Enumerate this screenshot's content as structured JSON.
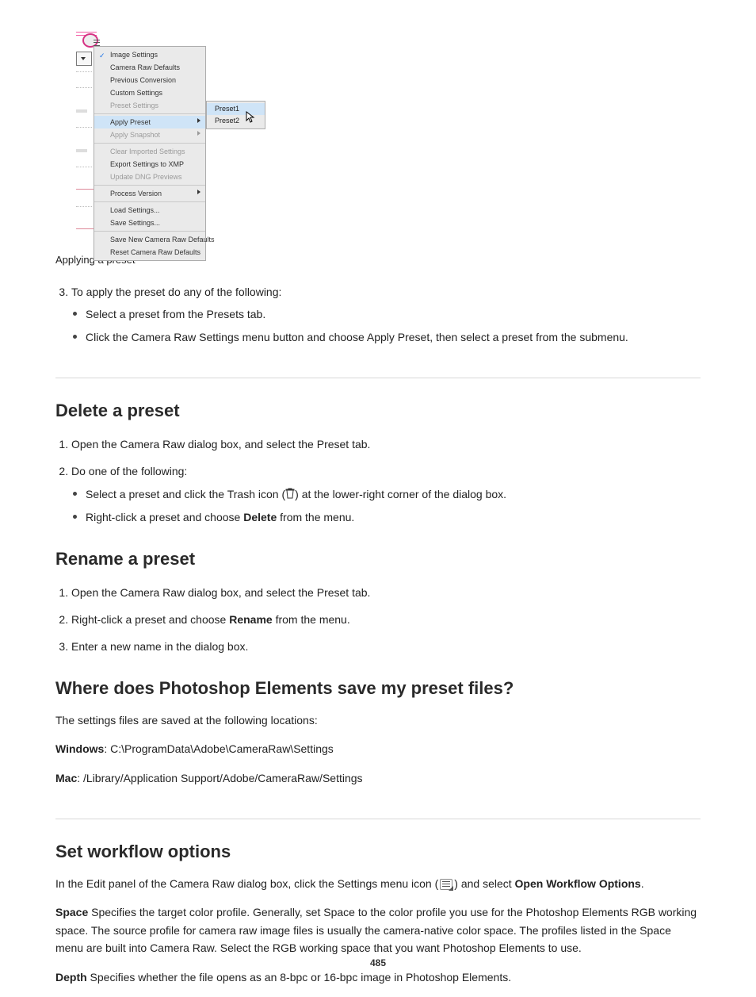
{
  "menu": {
    "group1": {
      "image_settings": "Image Settings",
      "camera_raw_defaults": "Camera Raw Defaults",
      "previous_conversion": "Previous Conversion",
      "custom_settings": "Custom Settings",
      "preset_settings": "Preset Settings"
    },
    "group2": {
      "apply_preset": "Apply Preset",
      "apply_snapshot": "Apply Snapshot"
    },
    "group3": {
      "clear_imported": "Clear Imported Settings",
      "export_xmp": "Export Settings to XMP",
      "update_dng": "Update DNG Previews"
    },
    "group4": {
      "process_version": "Process Version"
    },
    "group5": {
      "load_settings": "Load Settings...",
      "save_settings": "Save Settings..."
    },
    "group6": {
      "save_new_defaults": "Save New Camera Raw Defaults",
      "reset_defaults": "Reset Camera Raw Defaults"
    }
  },
  "submenu": {
    "preset1": "Preset1",
    "preset2": "Preset2"
  },
  "caption": "Applying a preset",
  "stepsA": {
    "s3_a": "Select a preset from the Presets tab.",
    "s3_b": "Click the Camera Raw Settings menu button and choose Apply Preset, then select a preset from the submenu.",
    "s3_intro": "To apply the preset do any of the following:"
  },
  "section2": {
    "title": "Delete a preset",
    "step1": "Open the Camera Raw dialog box, and select the Preset tab.",
    "step2_a": "Select a preset and click the Trash icon",
    "step2_b": ") at the lower-right corner of the dialog box.",
    "step2_alt": "Right-click a preset and choose ",
    "step2_alt_bold": "Delete",
    "step2_alt_tail": " from the menu.",
    "step2_intro": "Do one of the following:"
  },
  "section3": {
    "title": "Rename a preset",
    "step1": "Open the Camera Raw dialog box, and select the Preset tab.",
    "step2_a": "Right-click a preset and choose ",
    "step2_b_bold": "Rename",
    "step2_c": " from the menu.",
    "step3": "Enter a new name in the dialog box."
  },
  "section4": {
    "title": "Where does Photoshop Elements save my preset files?",
    "intro": "The settings files are saved at the following locations:",
    "win_label": "Windows",
    "win_path": ": C:\\ProgramData\\Adobe\\CameraRaw\\Settings",
    "mac_label": "Mac",
    "mac_path": ": /Library/Application Support/Adobe/CameraRaw/Settings"
  },
  "section5": {
    "title": "Set workflow options",
    "intro_a": "In the Edit panel of the Camera Raw dialog box, click the Settings menu icon (",
    "intro_b": ") and select ",
    "intro_bold": "Open Workflow Options",
    "intro_c": "."
  },
  "wf": {
    "space_label": "Space",
    "space_text": " Specifies the target color profile. Generally, set Space to the color profile you use for the Photoshop Elements RGB working space. The source profile for camera raw image files is usually the camera-native color space. The profiles listed in the Space menu are built into Camera Raw. Select the RGB working space that you want Photoshop Elements to use.",
    "depth_label": "Depth",
    "depth_text": " Specifies whether the file opens as an 8-bpc or 16-bpc image in Photoshop Elements."
  },
  "pagenum": "485"
}
